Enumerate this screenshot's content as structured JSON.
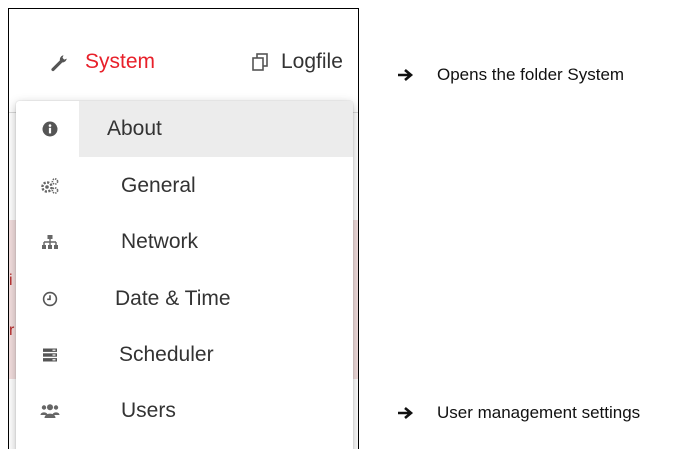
{
  "nav": {
    "system_label": "System",
    "logfile_label": "Logfile"
  },
  "menu": {
    "items": [
      {
        "label": "About",
        "icon": "info-circle-icon"
      },
      {
        "label": "General",
        "icon": "gears-icon"
      },
      {
        "label": "Network",
        "icon": "sitemap-icon"
      },
      {
        "label": "Date & Time",
        "icon": "clock-icon"
      },
      {
        "label": "Scheduler",
        "icon": "server-list-icon"
      },
      {
        "label": "Users",
        "icon": "users-icon"
      }
    ]
  },
  "notes": {
    "system": "Opens the folder System",
    "users": "User management settings"
  },
  "colors": {
    "accent": "#e8202a",
    "menu_active_bg": "#ececec",
    "alert_band": "#f3dede"
  }
}
